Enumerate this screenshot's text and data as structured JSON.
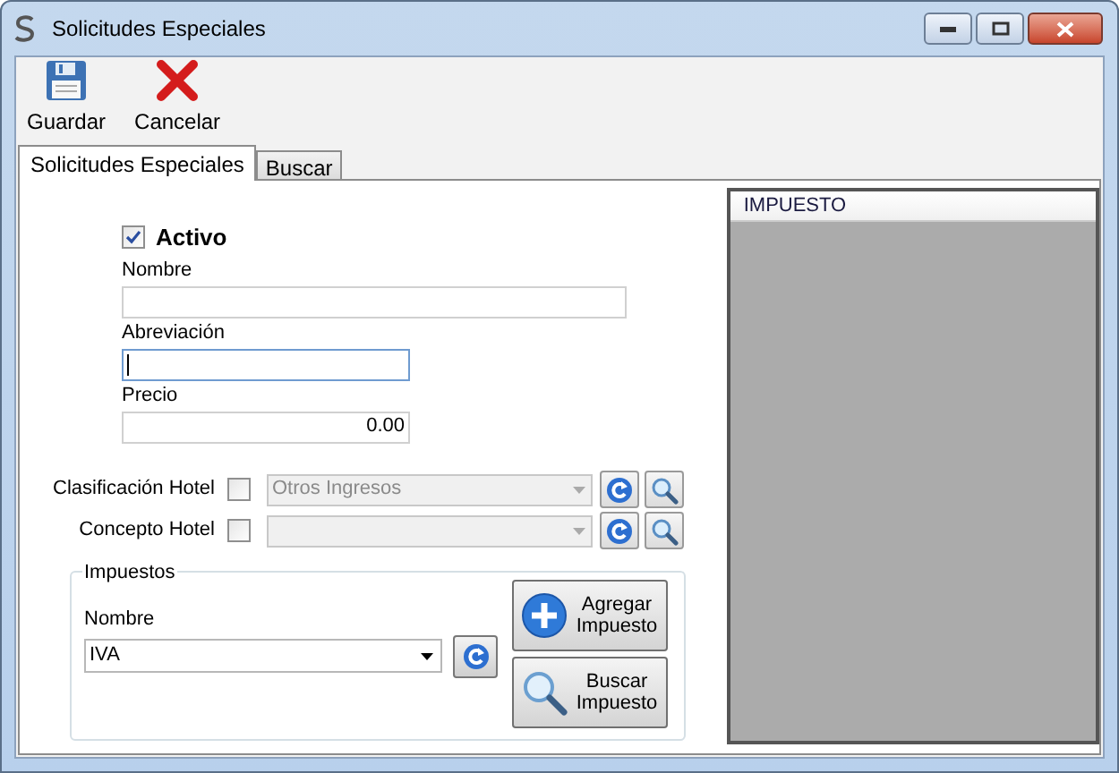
{
  "window": {
    "title": "Solicitudes Especiales"
  },
  "toolbar": [
    {
      "kind": "save",
      "label": "Guardar"
    },
    {
      "kind": "cancel",
      "label": "Cancelar"
    }
  ],
  "tabs": [
    {
      "label": "Solicitudes Especiales",
      "selected": true
    },
    {
      "label": "Buscar",
      "selected": false
    }
  ],
  "active": {
    "label": "Activo",
    "checked": true
  },
  "fields": [
    {
      "label": "Nombre",
      "kind": "wide",
      "focused": false
    },
    {
      "label": "Abreviación",
      "kind": "short",
      "focused": true
    },
    {
      "label": "Precio",
      "kind": "numeric",
      "value": "0.00",
      "focused": false
    }
  ],
  "hotel_rows": [
    {
      "label": "Clasificación Hotel",
      "checked": false,
      "value": "Otros Ingresos"
    },
    {
      "label": "Concepto Hotel",
      "checked": false
    }
  ],
  "taxes": {
    "title": "Impuestos",
    "label": "Nombre",
    "value": "IVA",
    "buttons": [
      {
        "kind": "add",
        "lines": [
          "Agregar",
          "Impuesto"
        ]
      },
      {
        "kind": "search",
        "lines": [
          "Buscar",
          "Impuesto"
        ]
      }
    ]
  },
  "grid": {
    "columns": [
      "IMPUESTO"
    ]
  }
}
